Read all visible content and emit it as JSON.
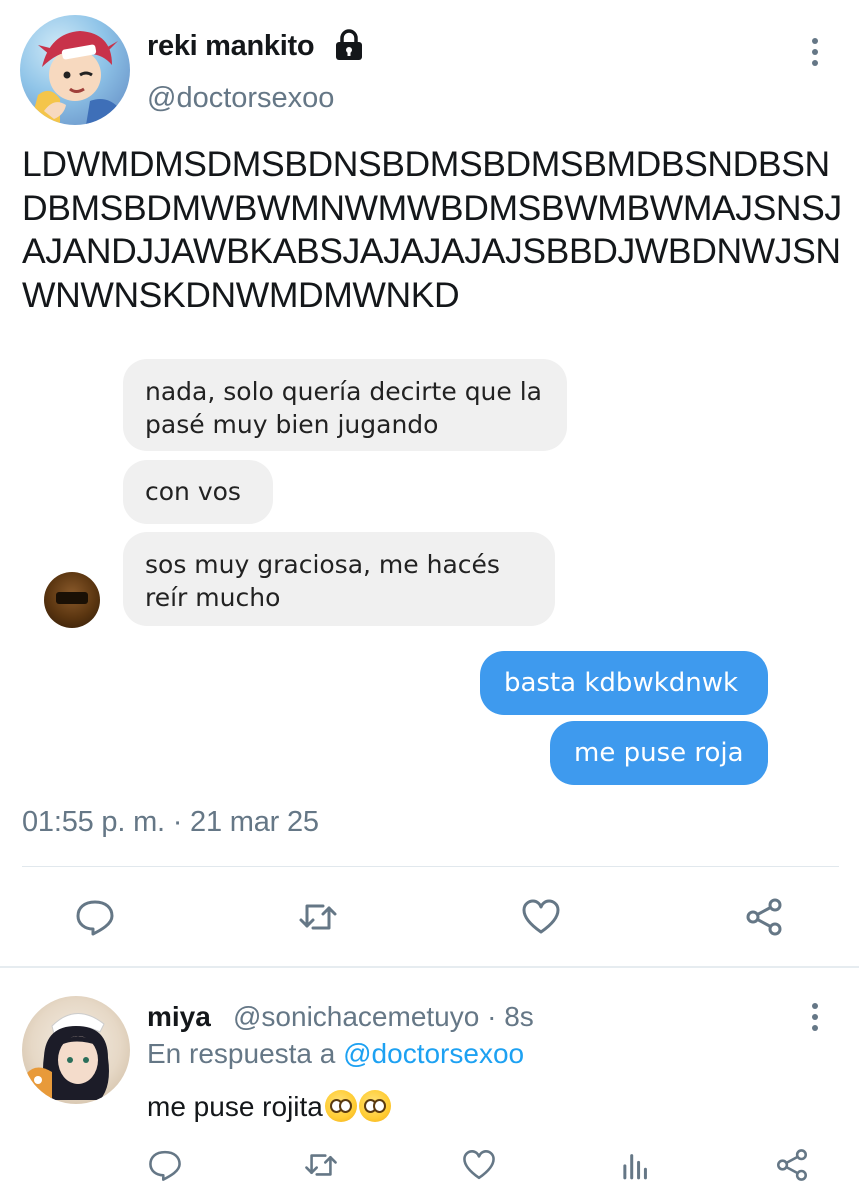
{
  "tweet": {
    "display_name": "reki mankito",
    "handle": "@doctorsexoo",
    "text": "LDWMDMSDMSBDNSBDMSBDMSBMDBSNDBSNDBMSBDMWBWMNWMWBDMSBWMBWMAJSNSJAJANDJJAWBKABSJAJAJAJAJSBBDJWBDNWJSNWNWNSKDNWMDMWNKD",
    "timestamp": "01:55 p. m. · 21 mar 25",
    "avatar_icon": "anime-avatar",
    "lock_icon": "lock-icon"
  },
  "chat": {
    "incoming": [
      "nada, solo quería decirte que la pasé muy bien jugando",
      "con vos",
      "sos muy graciosa, me hacés reír mucho"
    ],
    "outgoing": [
      "basta kdbwkdnwk",
      "me puse roja"
    ],
    "incoming_color": "#f0f0f0",
    "outgoing_color": "#3e9aee"
  },
  "actions": [
    "reply-icon",
    "retweet-icon",
    "like-icon",
    "share-icon"
  ],
  "reply": {
    "display_name": "miya",
    "handle_time": "@sonichacemetuyo · 8s",
    "reply_prefix": "En respuesta a",
    "reply_mention": "@doctorsexoo",
    "text": "me puse rojita",
    "emoji_icon": "pleading-face-emoji",
    "actions": [
      "reply-icon",
      "retweet-icon",
      "like-icon",
      "analytics-icon",
      "share-icon"
    ]
  },
  "colors": {
    "secondary_text": "#657786",
    "link": "#1da1f2",
    "divider": "#e1e8ed"
  }
}
